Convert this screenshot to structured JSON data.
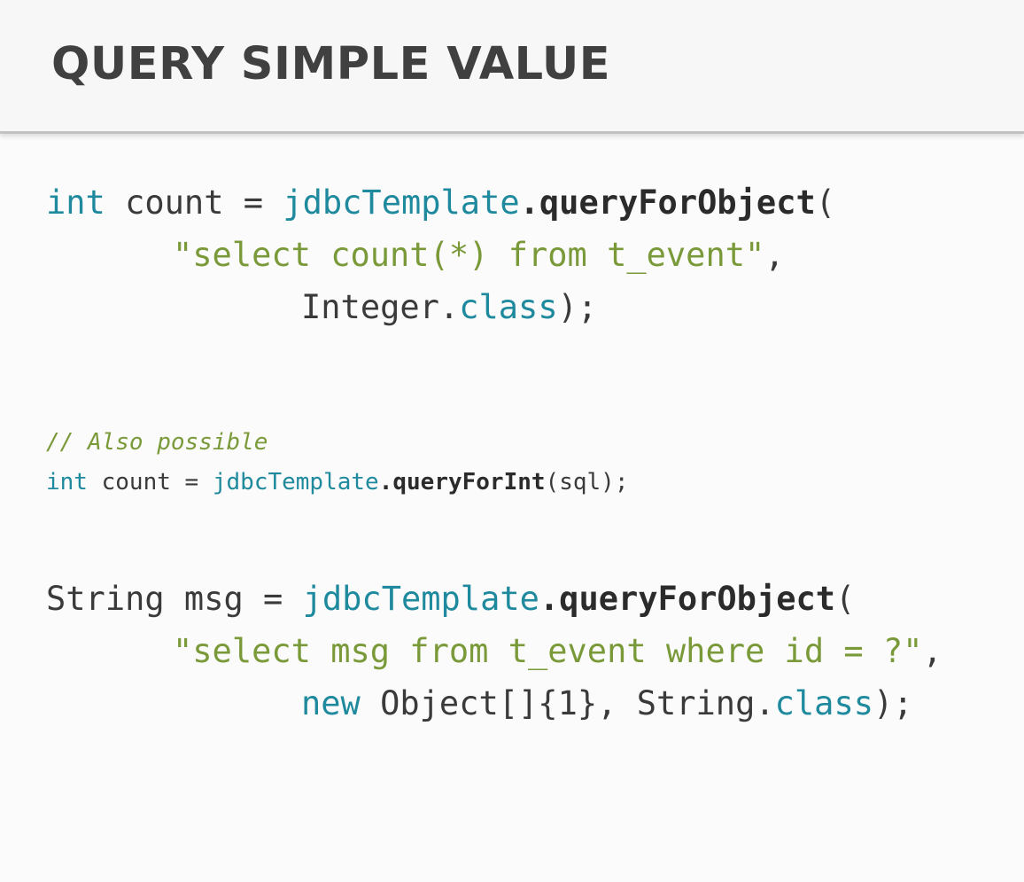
{
  "slide": {
    "title": "QUERY SIMPLE VALUE"
  },
  "code": {
    "block1": {
      "line1": {
        "kw_int": "int",
        "text_count": " count = ",
        "obj": "jdbcTemplate",
        "method": ".queryForObject",
        "paren": "("
      },
      "line2": {
        "string": "\"select count(*) from t_event\"",
        "comma": ","
      },
      "line3": {
        "text": "Integer.",
        "kw_class": "class",
        "end": ");"
      }
    },
    "block2": {
      "comment": "// Also possible",
      "line": {
        "kw_int": "int",
        "text_count": " count = ",
        "obj": "jdbcTemplate",
        "method": ".queryForInt",
        "args": "(sql);"
      }
    },
    "block3": {
      "line1": {
        "text": "String msg = ",
        "obj": "jdbcTemplate",
        "method": ".queryForObject",
        "paren": "("
      },
      "line2": {
        "string": "\"select msg from t_event where id = ?\"",
        "comma": ","
      },
      "line3": {
        "kw_new": "new",
        "text": " Object[]{1}, String.",
        "kw_class": "class",
        "end": ");"
      }
    }
  }
}
